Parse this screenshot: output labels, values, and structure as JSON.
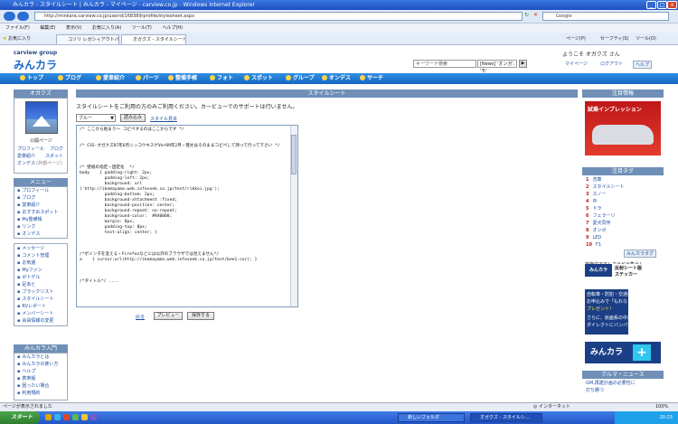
{
  "window": {
    "title": "みんカラ - スタイルシート | みんカラ - マイページ - carview.co.jp - Windows Internet Explorer",
    "address": "http://minkara.carview.co.jp/userid/168389/profile/stylesheet.aspx",
    "search_placeholder": "Google"
  },
  "menubar": [
    "ファイル(F)",
    "編集(E)",
    "表示(V)",
    "お気に入り(A)",
    "ツール(T)",
    "ヘルプ(H)"
  ],
  "favbar": {
    "favorites_label": "お気に入り",
    "tabs": [
      {
        "label": "コソリ レガシィアウトバック"
      },
      {
        "label": "オガクズ - スタイルシート..."
      }
    ],
    "tools": [
      "ページ(P)",
      "セーフティ(S)",
      "ツール(O)"
    ]
  },
  "header": {
    "brand_small": "carview group",
    "brand": "みんカラ",
    "welcome": "ようこそ オガクズ さん",
    "search_placeholder": "キーワード検索",
    "search_scope": "[News] 'オンガ', 'モ'",
    "links": [
      "マイページ",
      "ログアウト",
      "ヘルプ"
    ]
  },
  "nav": [
    "トップ",
    "ブログ",
    "愛車紹介",
    "パーツ",
    "整備手帳",
    "フォト",
    "スポット",
    "グループ",
    "オンデス",
    "サーチ"
  ],
  "left": {
    "user_head": "オガクズ",
    "public_page": "公開ページ",
    "public_links": [
      [
        "プロフィール",
        "ブログ"
      ],
      [
        "愛車紹介",
        "スポット"
      ]
    ],
    "gray_line": "オンデス",
    "gray_note": "(外部ページ)",
    "menu_head": "メニュー",
    "menu1": [
      "プロフィール",
      "ブログ",
      "愛車紹介",
      "おすすめスポット",
      "My整備帳",
      "リンク",
      "オンデス"
    ],
    "menu2": [
      "メッセージ",
      "コメント管理",
      "お気遣",
      "Myファン",
      "ボトデル",
      "足あと",
      "ブラックリスト",
      "スタイルシート",
      "RVレポート",
      "メンバーシート",
      "会員情報の変更"
    ],
    "intro_head": "みんカラ入門",
    "intro": [
      "みんカラとは",
      "みんカラの使い方",
      "ヘルプ",
      "携帯版",
      "困ったい場合",
      "利用規約"
    ]
  },
  "main": {
    "title": "スタイルシート",
    "notice": "スタイルシートをご利用の方のみご利用ください。カービューでのサポートは行いません。",
    "select_value": "ブルー",
    "load_button": "読み込み",
    "sheet_link": "スタイル見本",
    "css_text": "/* ここから始まり～ コピペするのはここからです */\n\n\n/* CSS-オガクズ07年6月ニッコウキスゲVer09年2月・雑文はそのままコピペして持って行って下さい */\n\n\n\n/* 壁紙の指定・固定化  */\nbody    { padding-right: 2px;\n          padding-left: 2px;\n          background: url\n('http://ikomayama.web.infoseek.co.jp/test/rikkoi.jpg');\n          padding-bottom: 2px;\n          background-attachment :fixed;\n          background-position: center;\n          background-repeat: no-repeat;\n          background-color:  #840000;\n          margin: 0px;\n          padding-top: 0px;\n          text-align: center; }\n\n\n\n/*ポインタを変える・Firefoxなどには以外のブラウザでは見えません*/\na    { cursor:url(http://ikomayama.web.infoseek.co.jp/test/bee1.cur); }\n\n\n\n/*タイトル*/ ....",
    "back_link": "戻る",
    "preview_button": "プレビュー",
    "save_button": "保存する"
  },
  "right": {
    "attention_head": "注目情報",
    "ad1_title": "試乗インプレッション",
    "tags_head": "注目タグ",
    "tags": [
      "洗車",
      "スタイルシート",
      "スノー",
      "中",
      "ドラ",
      "フェラーリ",
      "愛犬同伴",
      "オンボ",
      "LED",
      "F1"
    ],
    "tags_more": "みんカラタグ",
    "campaign_text": "実施中です！カラビテ集合！",
    "sticker_label": "みんカラ",
    "sticker_title": "反射シート版",
    "sticker_sub": "ステッカー",
    "sticker_line1": "自転車・防犯・交通運動",
    "sticker_line2": "お申込みで「もれなく」",
    "sticker_line3": "プレゼント！",
    "sticker_line4": "さらに、仮面系の中古なら",
    "sticker_line5": "ダイレクトにバンパーオーダー",
    "banner_text": "みんカラ",
    "banner_plus": "+",
    "news_head": "クルマ・ニュース",
    "news": [
      "GM,再建計画の必要性に",
      "打ち勝つ"
    ]
  },
  "status": {
    "text": "ページが表示されました",
    "zone": "インターネット",
    "zoom": "100%"
  },
  "taskbar": {
    "start": "スタート",
    "tasks": [
      "新しいフォルダ",
      "オガクズ - スタイルシ..."
    ],
    "clock": "20:23"
  }
}
